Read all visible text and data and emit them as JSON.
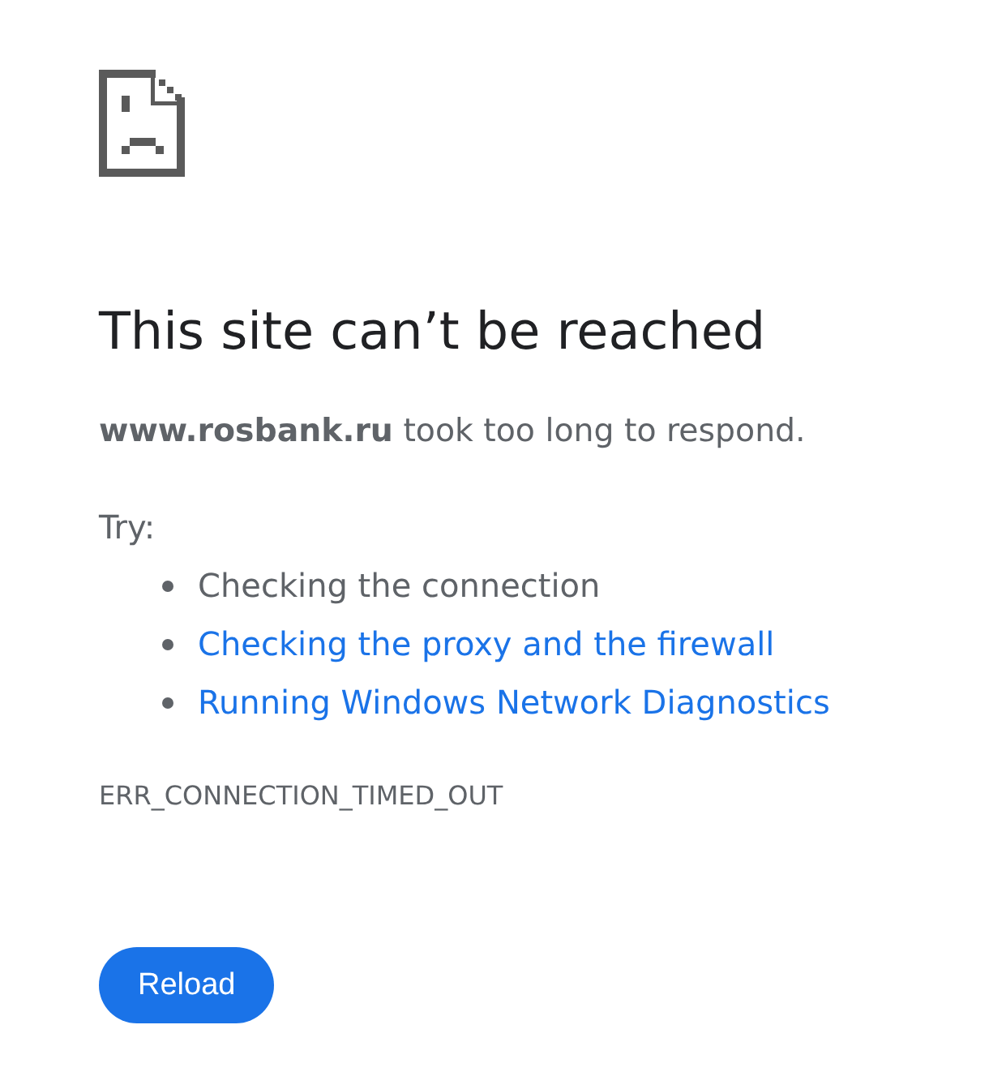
{
  "heading": "This site can’t be reached",
  "message": "**www.rosbank.ru** took too long to respond.",
  "suggestions": {
    "label": "Try:",
    "items": [
      {
        "text": "Checking the connection",
        "kind": "text"
      },
      {
        "text": "Checking the proxy and the firewall",
        "kind": "link"
      },
      {
        "text": "Running Windows Network Diagnostics",
        "kind": "link"
      }
    ]
  },
  "error_code": "ERR_CONNECTION_TIMED_OUT",
  "buttons": [
    {
      "label": "Reload"
    }
  ]
}
